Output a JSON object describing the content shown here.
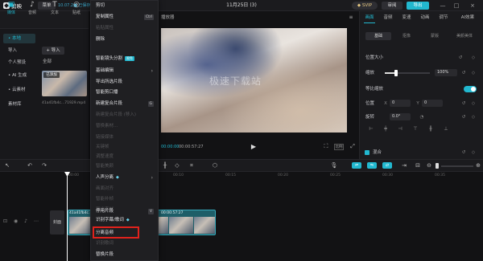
{
  "app": {
    "name": "剪映",
    "menu_label": "菜单",
    "version_text": "10.07.2■ 已保存",
    "doc_title": "11月25日 (3)",
    "svip_label": "SVIP",
    "review_label": "审阅",
    "export_label": "导出",
    "window_controls": [
      "—",
      "□",
      "×"
    ]
  },
  "left_tabs": [
    {
      "icon": "▣",
      "label": "媒体",
      "active": true
    },
    {
      "icon": "♪",
      "label": "音频",
      "active": false
    },
    {
      "icon": "T",
      "label": "文本",
      "active": false
    },
    {
      "icon": "◎",
      "label": "贴纸",
      "active": false
    }
  ],
  "left_nav": [
    {
      "label": "• 本地",
      "active": true
    },
    {
      "label": "导入",
      "active": false
    },
    {
      "label": "个人预设",
      "active": false
    },
    {
      "label": "• AI 生成",
      "active": false
    },
    {
      "label": "• 云素材",
      "active": false
    },
    {
      "label": "素材库",
      "active": false
    }
  ],
  "media": {
    "import_label": "+ 导入",
    "all_label": "全部",
    "thumb_badge": "已添加",
    "thumb_name": "41a41fb4c...71929.mp4"
  },
  "context_menu": [
    {
      "label": "剪切",
      "shortcut": "",
      "disabled": false,
      "arrow": false
    },
    {
      "label": "复制属性",
      "shortcut": "Ctrl",
      "disabled": false,
      "arrow": false
    },
    {
      "label": "粘贴属性",
      "shortcut": "",
      "disabled": true,
      "arrow": false
    },
    {
      "label": "删除",
      "shortcut": "",
      "disabled": false,
      "arrow": false
    },
    {
      "label": "智能镜头分割",
      "shortcut": "",
      "disabled": false,
      "arrow": false,
      "tag": "限免"
    },
    {
      "label": "基础编辑",
      "shortcut": "",
      "disabled": false,
      "arrow": true
    },
    {
      "label": "导出所选片段",
      "shortcut": "",
      "disabled": false,
      "arrow": false
    },
    {
      "label": "智能剪口播",
      "shortcut": "",
      "disabled": false,
      "arrow": false
    },
    {
      "label": "新建复合片段",
      "shortcut": "G",
      "disabled": false,
      "arrow": false
    },
    {
      "label": "新建复合片段 (移入)",
      "shortcut": "",
      "disabled": true,
      "arrow": false
    },
    {
      "label": "替换素材…",
      "shortcut": "",
      "disabled": true,
      "arrow": false
    },
    {
      "label": "链接媒体",
      "shortcut": "",
      "disabled": true,
      "arrow": false
    },
    {
      "label": "关键帧",
      "shortcut": "",
      "disabled": true,
      "arrow": false
    },
    {
      "label": "调整速度",
      "shortcut": "",
      "disabled": true,
      "arrow": false
    },
    {
      "label": "智能美颜",
      "shortcut": "",
      "disabled": true,
      "arrow": false
    },
    {
      "label": "人声分离",
      "shortcut": "",
      "disabled": false,
      "arrow": true,
      "gem": true
    },
    {
      "label": "画面对齐",
      "shortcut": "",
      "disabled": true,
      "arrow": false
    },
    {
      "label": "智能补帧",
      "shortcut": "",
      "disabled": true,
      "arrow": false
    },
    {
      "label": "导出素材",
      "shortcut": "",
      "disabled": true,
      "arrow": false
    },
    {
      "label": "停用片段",
      "shortcut": "V",
      "disabled": false,
      "arrow": false
    },
    {
      "label": "识别字幕/歌词",
      "shortcut": "",
      "disabled": false,
      "arrow": false,
      "gem": true
    },
    {
      "label": "分离音频",
      "shortcut": "",
      "disabled": false,
      "arrow": false
    },
    {
      "label": "识别歌词",
      "shortcut": "",
      "disabled": true,
      "arrow": false
    },
    {
      "label": "替换片段",
      "shortcut": "",
      "disabled": false,
      "arrow": false
    }
  ],
  "player": {
    "title": "播放器",
    "watermark": "极速下载站",
    "time_current": "00:00:00",
    "time_total": "00:00:57:27",
    "play_icon": "▶",
    "ratio_label": "比例"
  },
  "right_panel": {
    "tabs": [
      {
        "label": "画面",
        "active": true
      },
      {
        "label": "音频",
        "active": false
      },
      {
        "label": "变速",
        "active": false
      },
      {
        "label": "动画",
        "active": false
      },
      {
        "label": "调节",
        "active": false
      },
      {
        "label": "AI效果",
        "active": false
      }
    ],
    "subtabs": [
      {
        "label": "基础",
        "active": true
      },
      {
        "label": "抠像",
        "active": false
      },
      {
        "label": "蒙版",
        "active": false
      },
      {
        "label": "美颜美体",
        "active": false
      }
    ],
    "section_position": "位置大小",
    "scale_label": "缩放",
    "scale_value": "100%",
    "uniform_label": "等比缩放",
    "position_label": "位置",
    "pos_x_label": "X",
    "pos_x": "0",
    "pos_y_label": "Y",
    "pos_y": "0",
    "rotate_label": "旋转",
    "rotate_value": "0.0°",
    "blend_label": "混合"
  },
  "timeline": {
    "ticks": [
      "00:00",
      "00:05",
      "00:10",
      "00:15",
      "00:20",
      "00:25",
      "00:30",
      "00:35"
    ],
    "cover_label": "封面",
    "clip_label": "41a41fb4c...71929.mp4",
    "clip_time": "00:00:57:27"
  }
}
